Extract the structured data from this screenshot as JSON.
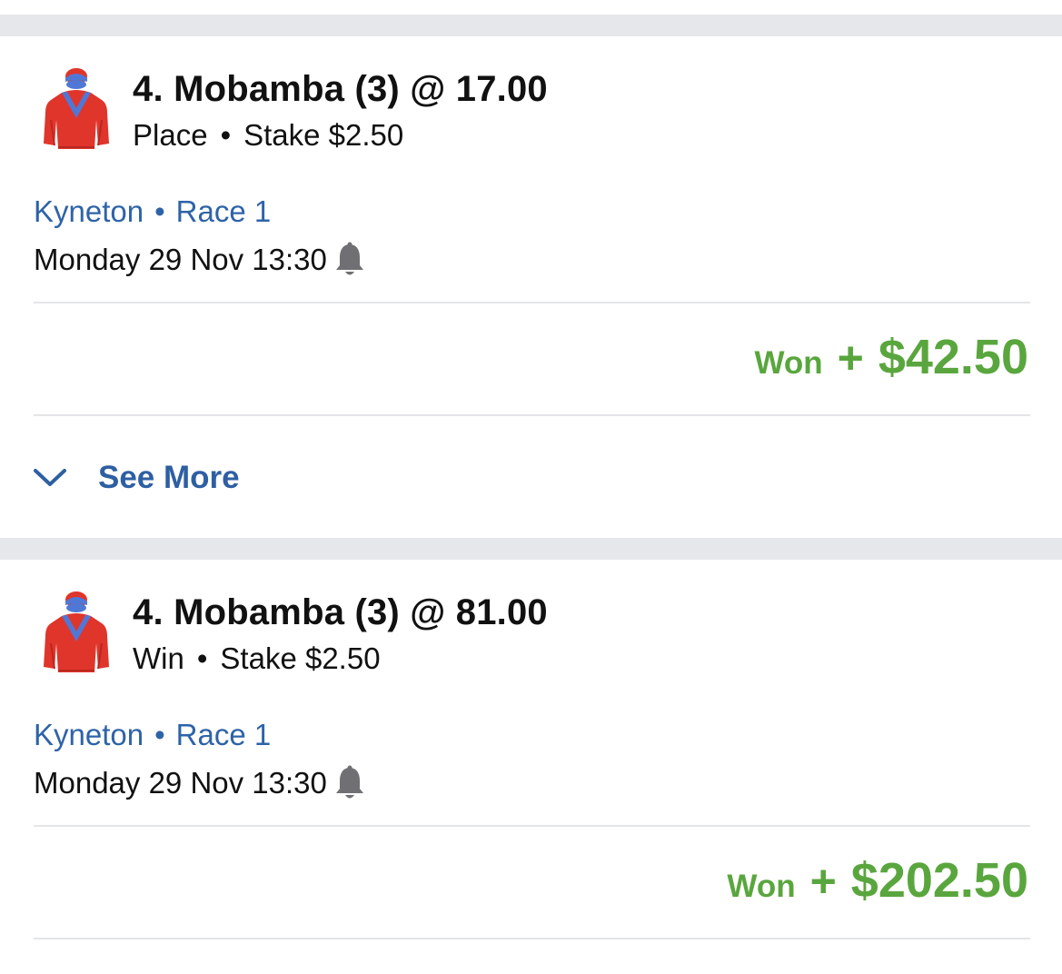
{
  "bets": [
    {
      "runner_title": "4. Mobamba (3) @ 17.00",
      "bet_type": "Place",
      "stake": "Stake $2.50",
      "separator": "•",
      "venue": "Kyneton",
      "race": "Race 1",
      "race_time": "Monday 29 Nov 13:30",
      "result_label": "Won",
      "result_sign": "+",
      "result_amount": "$42.50",
      "see_more_label": "See More"
    },
    {
      "runner_title": "4. Mobamba (3) @ 81.00",
      "bet_type": "Win",
      "stake": "Stake $2.50",
      "separator": "•",
      "venue": "Kyneton",
      "race": "Race 1",
      "race_time": "Monday 29 Nov 13:30",
      "result_label": "Won",
      "result_sign": "+",
      "result_amount": "$202.50"
    }
  ],
  "icons": {
    "silks": "jockey-silks-icon",
    "bell": "bell-icon",
    "chevron": "chevron-down-icon"
  },
  "colors": {
    "link_blue": "#2e63a8",
    "win_green": "#5aa63e",
    "silks_red": "#e0352b",
    "silks_blue": "#4f78d6",
    "separator_grey": "#e6e7ea"
  }
}
